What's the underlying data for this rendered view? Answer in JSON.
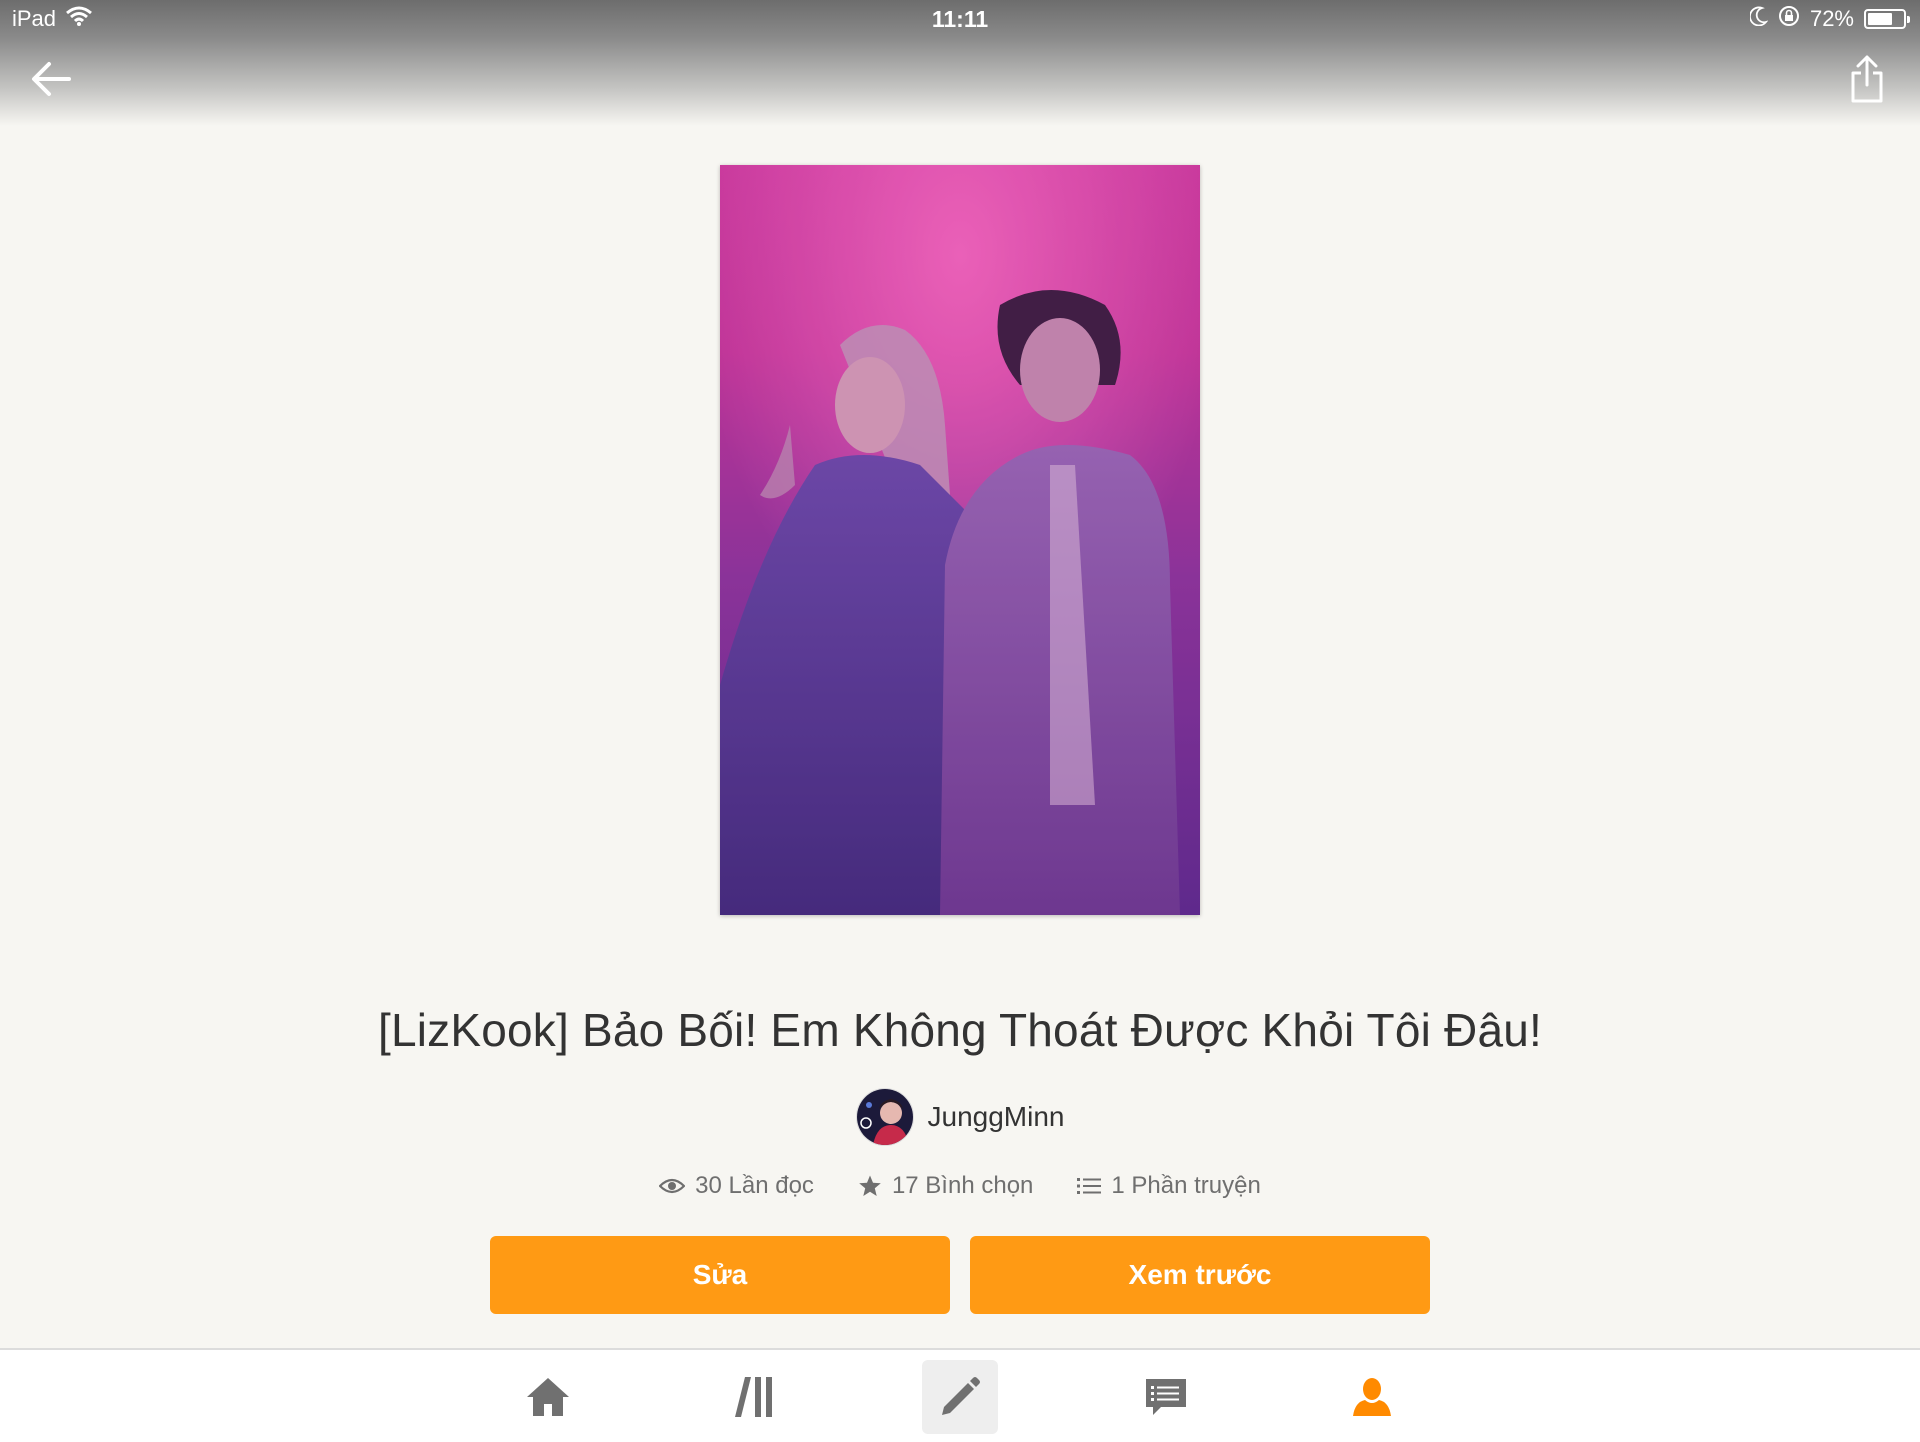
{
  "status_bar": {
    "device": "iPad",
    "time": "11:11",
    "battery": "72%",
    "battery_level": 0.72
  },
  "header": {
    "back_icon": "arrow-left-icon",
    "share_icon": "share-icon"
  },
  "story": {
    "title": "[LizKook] Bảo Bối! Em Không Thoát Được Khỏi Tôi Đâu!",
    "author": "JunggMinn",
    "stats": {
      "reads": "30 Lần đọc",
      "votes": "17 Bình chọn",
      "parts": "1 Phần truyện"
    }
  },
  "actions": {
    "edit_label": "Sửa",
    "preview_label": "Xem trước"
  },
  "tab_bar": {
    "items": [
      {
        "name": "home",
        "icon": "home-icon"
      },
      {
        "name": "library",
        "icon": "library-icon"
      },
      {
        "name": "write",
        "icon": "pencil-icon",
        "selected": true
      },
      {
        "name": "messages",
        "icon": "chat-icon"
      },
      {
        "name": "profile",
        "icon": "person-icon",
        "color": "#ff8a00"
      }
    ]
  },
  "colors": {
    "accent": "#ff9a14",
    "background": "#f7f6f2",
    "cover_magenta": "#e0409f",
    "cover_purple": "#5a2a90"
  }
}
